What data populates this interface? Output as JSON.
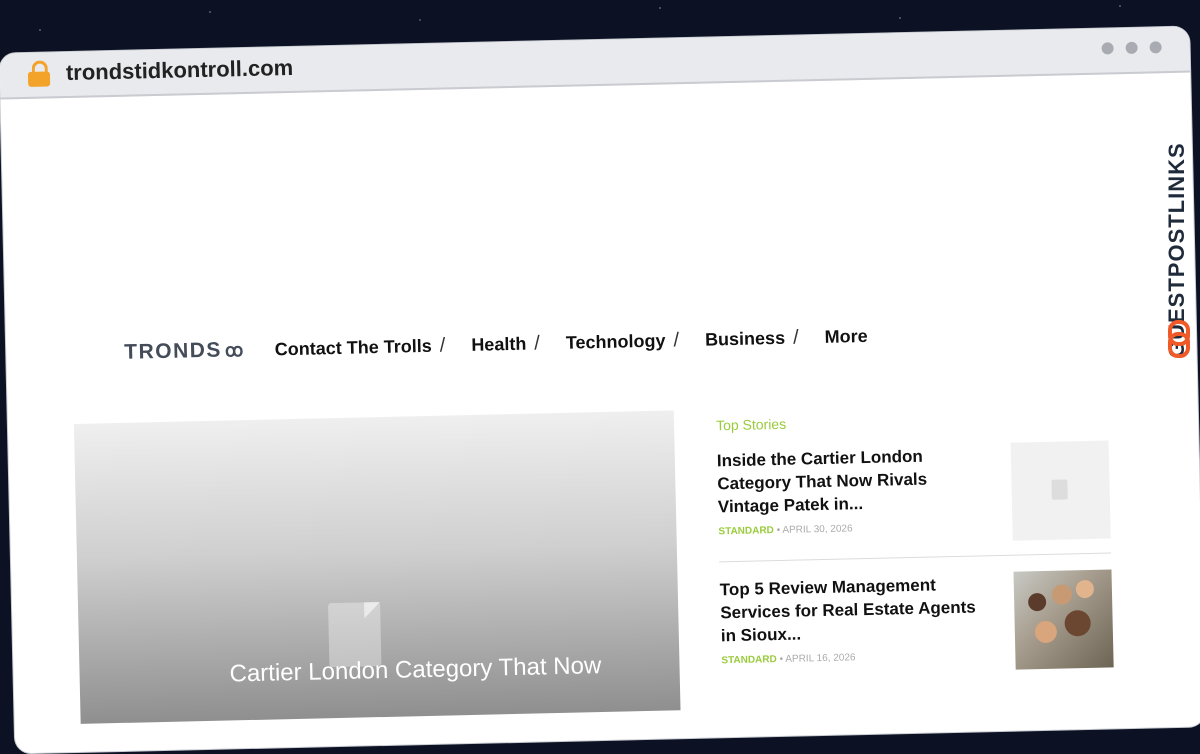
{
  "browser": {
    "url": "trondstidkontroll.com"
  },
  "site": {
    "logo_text": "TRONDS",
    "logo_mark": "ꝏ",
    "nav": [
      {
        "label": "Contact The Trolls",
        "sep": "/"
      },
      {
        "label": "Health",
        "sep": "/"
      },
      {
        "label": "Technology",
        "sep": "/"
      },
      {
        "label": "Business",
        "sep": "/"
      },
      {
        "label": "More"
      }
    ]
  },
  "hero": {
    "title": "Cartier London Category That Now"
  },
  "sidebar": {
    "heading": "Top Stories",
    "stories": [
      {
        "title": "Inside the Cartier London Category That Now Rivals Vintage Patek in...",
        "category": "STANDARD",
        "dot": "•",
        "date": "APRIL 30, 2026"
      },
      {
        "title": "Top 5 Review Management Services for Real Estate Agents in Sioux...",
        "category": "STANDARD",
        "dot": "•",
        "date": "APRIL 16, 2026"
      }
    ]
  },
  "badge": {
    "text": "GUESTPOSTLINKS"
  },
  "colors": {
    "accent": "#9acb3c",
    "badge": "#f05a28",
    "lock": "#f3a22a"
  }
}
